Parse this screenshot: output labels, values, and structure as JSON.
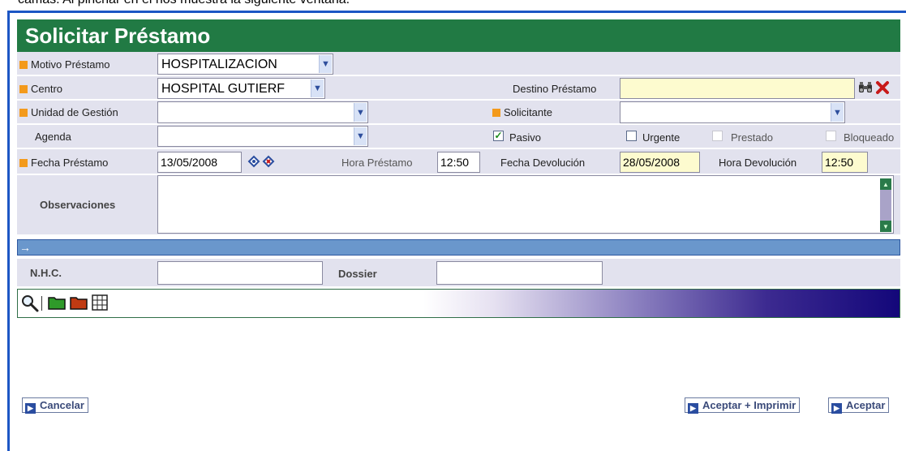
{
  "doc_text": "camas. Al pinchar en él nos muestra la siguiente ventana.",
  "title": "Solicitar Préstamo",
  "form": {
    "motivo_label": "Motivo Préstamo",
    "motivo_value": "HOSPITALIZACION",
    "centro_label": "Centro",
    "centro_value": "HOSPITAL GUTIERF",
    "destino_label": "Destino Préstamo",
    "destino_value": "",
    "unidad_label": "Unidad de Gestión",
    "unidad_value": "",
    "solicitante_label": "Solicitante",
    "solicitante_value": "",
    "agenda_label": "Agenda",
    "agenda_value": "",
    "pasivo_label": "Pasivo",
    "pasivo_checked": true,
    "urgente_label": "Urgente",
    "prestado_label": "Prestado",
    "bloqueado_label": "Bloqueado",
    "fecha_prestamo_label": "Fecha Préstamo",
    "fecha_prestamo_value": "13/05/2008",
    "hora_prestamo_label": "Hora Préstamo",
    "hora_prestamo_value": "12:50",
    "fecha_devolucion_label": "Fecha Devolución",
    "fecha_devolucion_value": "28/05/2008",
    "hora_devolucion_label": "Hora Devolución",
    "hora_devolucion_value": "12:50",
    "observaciones_label": "Observaciones",
    "observaciones_value": ""
  },
  "search": {
    "nhc_label": "N.H.C.",
    "nhc_value": "",
    "dossier_label": "Dossier",
    "dossier_value": ""
  },
  "toolbar": {
    "icons": [
      "search-icon",
      "green-folder-icon",
      "red-folder-icon",
      "grid-icon"
    ]
  },
  "buttons": {
    "cancelar": "Cancelar",
    "aceptar_imprimir": "Aceptar + Imprimir",
    "aceptar": "Aceptar"
  },
  "colors": {
    "title_bg": "#217a44",
    "required_marker": "#f39a1c",
    "row_bg": "#e2e2ee",
    "bar_blue": "#6a97cc",
    "window_border": "#1c56c4"
  }
}
